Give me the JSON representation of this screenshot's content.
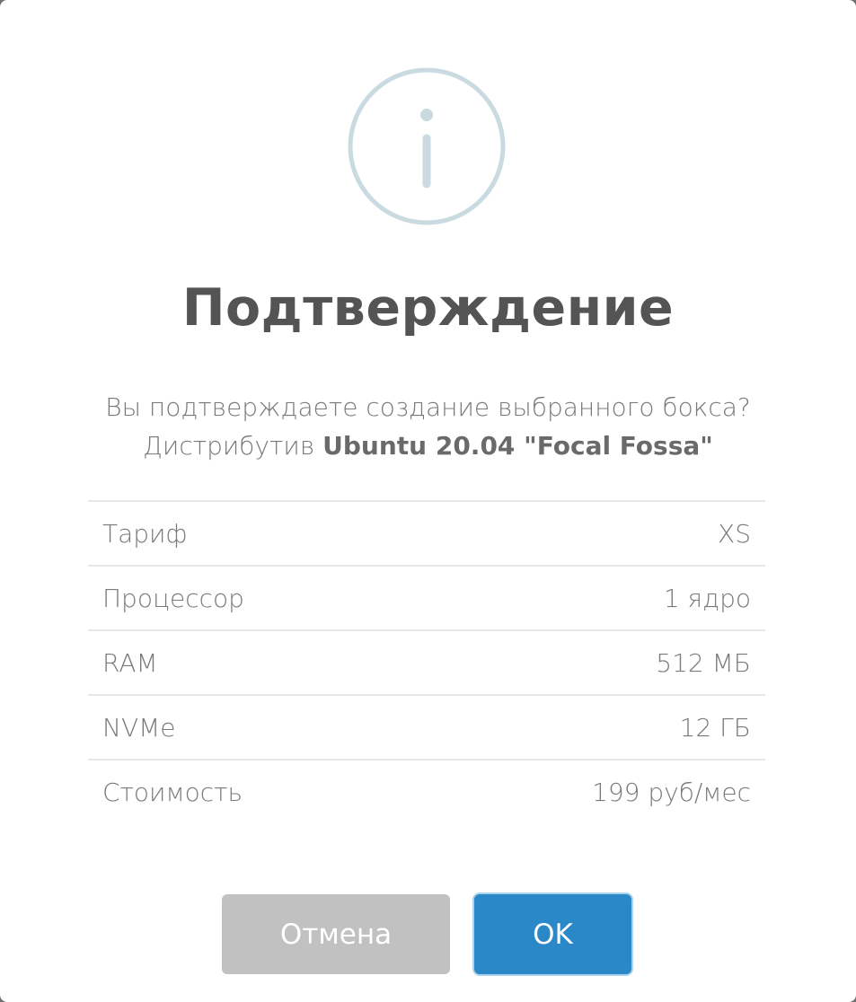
{
  "dialog": {
    "icon": "info-icon",
    "title": "Подтверждение",
    "message_line1": "Вы подтверждаете создание выбранного бокса?",
    "message_line2_prefix": "Дистрибутив ",
    "message_line2_bold": "Ubuntu 20.04 \"Focal Fossa\"",
    "details": [
      {
        "label": "Тариф",
        "value": "XS"
      },
      {
        "label": "Процессор",
        "value": "1 ядро"
      },
      {
        "label": "RAM",
        "value": "512 МБ"
      },
      {
        "label": "NVMe",
        "value": "12 ГБ"
      },
      {
        "label": "Стоимость",
        "value": "199 руб/мес"
      }
    ],
    "buttons": {
      "cancel_label": "Отмена",
      "ok_label": "OK"
    },
    "colors": {
      "ok_button": "#2a87c8",
      "cancel_button": "#c1c1c1",
      "icon_stroke": "#c9dae1"
    }
  }
}
